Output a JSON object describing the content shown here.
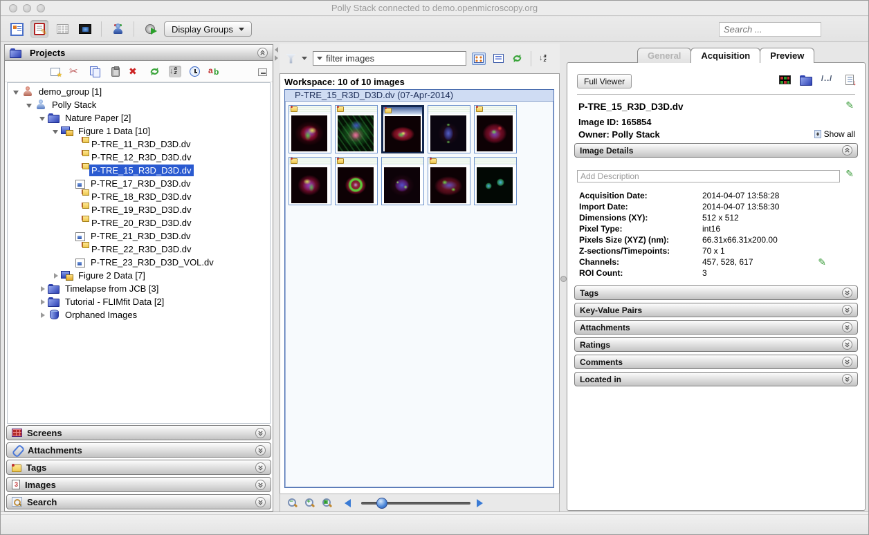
{
  "window": {
    "title": "Polly Stack connected to demo.openmicroscopy.org"
  },
  "colors": {
    "selection_blue": "#2a5ad0",
    "frame_title_bg": "#cfdcf3",
    "thumb_border": "#6e93cc",
    "thumb_selected_border": "#14284f",
    "pencil_green": "#3a9c3a",
    "chrome_gray": "#ececec"
  },
  "icons": {
    "browser-view-icon": "blue-bordered tree view",
    "editor-view-icon": "red clipboard with pencil",
    "grid-view-icon": "gray grid (disabled)",
    "screen-view-icon": "dark monitor with blue image",
    "user-icon": "person silhouette",
    "importer-icon": "gray disc with green arrow",
    "funnel-icon": "filter funnel",
    "magnifier-icon": "zoom magnifier",
    "pencil-icon": "green edit pencil",
    "chevron-double": "circled double chevron",
    "tag-icon": "yellow note with red dot"
  },
  "apptoolbar": {
    "display_groups_label": "Display Groups",
    "search_placeholder": "Search ..."
  },
  "projects_panel": {
    "title": "Projects",
    "tree": [
      {
        "lvl": "lv0",
        "exp": "open",
        "icon": "user-red",
        "label": "demo_group [1]"
      },
      {
        "lvl": "lv1",
        "exp": "open",
        "icon": "user-blue",
        "label": "Polly Stack"
      },
      {
        "lvl": "lv2",
        "exp": "open",
        "icon": "folder",
        "label": "Nature Paper [2]"
      },
      {
        "lvl": "lv3",
        "exp": "open",
        "icon": "dataset",
        "label": "Figure 1 Data [10]"
      },
      {
        "lvl": "lv4",
        "exp": "none",
        "icon": "img-tag",
        "label": "P-TRE_11_R3D_D3D.dv"
      },
      {
        "lvl": "lv4",
        "exp": "none",
        "icon": "img-tag",
        "label": "P-TRE_12_R3D_D3D.dv"
      },
      {
        "lvl": "lv4",
        "exp": "none",
        "icon": "img-tag",
        "label": "P-TRE_15_R3D_D3D.dv",
        "sel": "selected-row"
      },
      {
        "lvl": "lv4",
        "exp": "none",
        "icon": "img",
        "label": "P-TRE_17_R3D_D3D.dv"
      },
      {
        "lvl": "lv4",
        "exp": "none",
        "icon": "img-tag",
        "label": "P-TRE_18_R3D_D3D.dv"
      },
      {
        "lvl": "lv4",
        "exp": "none",
        "icon": "img-tag",
        "label": "P-TRE_19_R3D_D3D.dv"
      },
      {
        "lvl": "lv4",
        "exp": "none",
        "icon": "img-tag",
        "label": "P-TRE_20_R3D_D3D.dv"
      },
      {
        "lvl": "lv4",
        "exp": "none",
        "icon": "img",
        "label": "P-TRE_21_R3D_D3D.dv"
      },
      {
        "lvl": "lv4",
        "exp": "none",
        "icon": "img-tag",
        "label": "P-TRE_22_R3D_D3D.dv"
      },
      {
        "lvl": "lv4",
        "exp": "none",
        "icon": "img",
        "label": "P-TRE_23_R3D_D3D_VOL.dv"
      },
      {
        "lvl": "lv3",
        "exp": "closed",
        "icon": "dataset",
        "label": "Figure 2 Data [7]"
      },
      {
        "lvl": "lv2",
        "exp": "closed",
        "icon": "folder",
        "label": "Timelapse from JCB [3]"
      },
      {
        "lvl": "lv2",
        "exp": "closed",
        "icon": "folder",
        "label": "Tutorial - FLIMfit Data [2]"
      },
      {
        "lvl": "lv2",
        "exp": "closed",
        "icon": "db",
        "label": "Orphaned Images"
      }
    ],
    "sections": [
      {
        "icon": "sec-screens",
        "label": "Screens"
      },
      {
        "icon": "sec-attach",
        "label": "Attachments"
      },
      {
        "icon": "sec-tag",
        "label": "Tags"
      },
      {
        "icon": "sec-images",
        "label": "Images"
      },
      {
        "icon": "sec-search",
        "label": "Search"
      }
    ]
  },
  "workspace": {
    "filter_placeholder": "filter images",
    "status": "Workspace: 10 of 10 images",
    "frame_title": "P-TRE_15_R3D_D3D.dv (07-Apr-2014)",
    "thumbnails": [
      {
        "variant": "t1",
        "tagged": true,
        "sel": ""
      },
      {
        "variant": "t2",
        "tagged": true,
        "sel": ""
      },
      {
        "variant": "t3",
        "tagged": true,
        "sel": "selected"
      },
      {
        "variant": "t4",
        "tagged": false,
        "sel": ""
      },
      {
        "variant": "t5",
        "tagged": true,
        "sel": ""
      },
      {
        "variant": "t6",
        "tagged": true,
        "sel": ""
      },
      {
        "variant": "t7",
        "tagged": true,
        "sel": ""
      },
      {
        "variant": "t8",
        "tagged": false,
        "sel": ""
      },
      {
        "variant": "t9",
        "tagged": true,
        "sel": ""
      },
      {
        "variant": "t10",
        "tagged": false,
        "sel": ""
      }
    ]
  },
  "metadata_panel": {
    "tabs": [
      {
        "label": "General",
        "state": "active"
      },
      {
        "label": "Acquisition",
        "state": ""
      },
      {
        "label": "Preview",
        "state": ""
      }
    ],
    "full_viewer_label": "Full Viewer",
    "analyse_icon_text": "/../",
    "image_name": "P-TRE_15_R3D_D3D.dv",
    "image_id": "Image ID: 165854",
    "owner": "Owner: Polly Stack",
    "show_all_label": "Show all",
    "details_header": "Image Details",
    "description_placeholder": "Add Description",
    "details": [
      {
        "label": "Acquisition Date:",
        "value": "2014-04-07 13:58:28"
      },
      {
        "label": "Import Date:",
        "value": "2014-04-07 13:58:30"
      },
      {
        "label": "Dimensions (XY):",
        "value": "512 x 512"
      },
      {
        "label": "Pixel Type:",
        "value": "int16"
      },
      {
        "label": "Pixels Size (XYZ) (nm):",
        "value": "66.31x66.31x200.00"
      },
      {
        "label": "Z-sections/Timepoints:",
        "value": "70 x 1"
      },
      {
        "label": "Channels:",
        "value": "457, 528, 617",
        "editable": true
      },
      {
        "label": "ROI Count:",
        "value": "3"
      }
    ],
    "sections": [
      {
        "label": "Tags"
      },
      {
        "label": "Key-Value Pairs"
      },
      {
        "label": "Attachments"
      },
      {
        "label": "Ratings"
      },
      {
        "label": "Comments"
      },
      {
        "label": "Located in"
      }
    ]
  }
}
